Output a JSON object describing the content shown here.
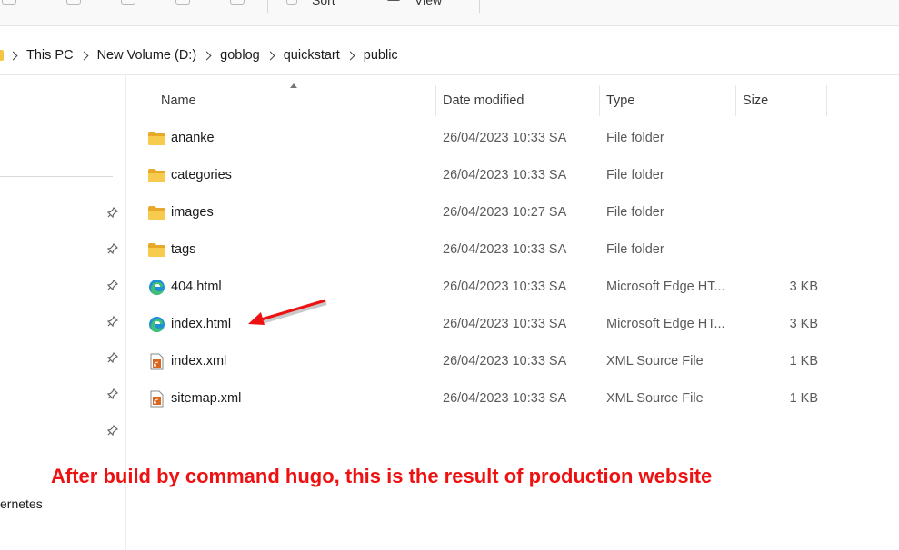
{
  "toolbar": {
    "sort_label": "Sort",
    "view_label": "View"
  },
  "breadcrumb": [
    "This PC",
    "New Volume (D:)",
    "goblog",
    "quickstart",
    "public"
  ],
  "columns": {
    "name": "Name",
    "date_modified": "Date modified",
    "type": "Type",
    "size": "Size"
  },
  "files": [
    {
      "name": "ananke",
      "date": "26/04/2023 10:33 SA",
      "type": "File folder",
      "size": "",
      "icon": "folder-icon"
    },
    {
      "name": "categories",
      "date": "26/04/2023 10:33 SA",
      "type": "File folder",
      "size": "",
      "icon": "folder-icon"
    },
    {
      "name": "images",
      "date": "26/04/2023 10:27 SA",
      "type": "File folder",
      "size": "",
      "icon": "folder-icon"
    },
    {
      "name": "tags",
      "date": "26/04/2023 10:33 SA",
      "type": "File folder",
      "size": "",
      "icon": "folder-icon"
    },
    {
      "name": "404.html",
      "date": "26/04/2023 10:33 SA",
      "type": "Microsoft Edge HT...",
      "size": "3 KB",
      "icon": "edge-icon"
    },
    {
      "name": "index.html",
      "date": "26/04/2023 10:33 SA",
      "type": "Microsoft Edge HT...",
      "size": "3 KB",
      "icon": "edge-icon"
    },
    {
      "name": "index.xml",
      "date": "26/04/2023 10:33 SA",
      "type": "XML Source File",
      "size": "1 KB",
      "icon": "xml-file-icon"
    },
    {
      "name": "sitemap.xml",
      "date": "26/04/2023 10:33 SA",
      "type": "XML Source File",
      "size": "1 KB",
      "icon": "xml-file-icon"
    }
  ],
  "navpane": {
    "partial_label": "ernetes"
  },
  "annotation": {
    "text": "After build by command hugo, this is the result of production website",
    "color": "#ee1111"
  },
  "colors": {
    "folder": "#f4c542",
    "edge": "#1f8fd6",
    "xml": "#c8661e"
  }
}
